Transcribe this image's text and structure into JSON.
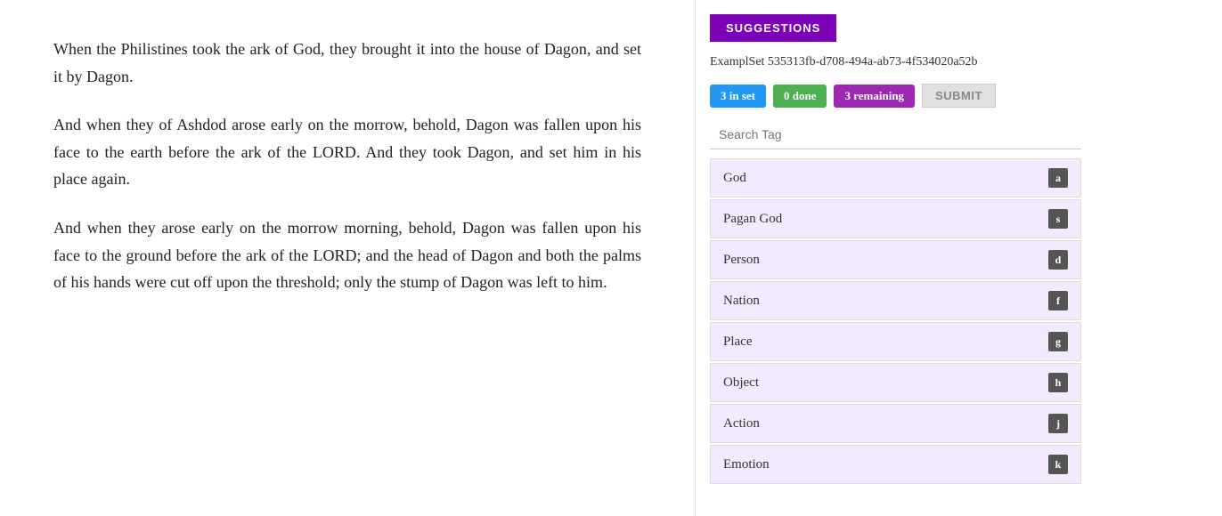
{
  "content": {
    "paragraphs": [
      "When the Philistines took the ark of God, they brought it into the house of Dagon, and set it by Dagon.",
      "And when they of Ashdod arose early on the morrow, behold, Dagon was fallen upon his face to the earth before the ark of the LORD. And they took Dagon, and set him in his place again.",
      "And when they arose early on the morrow morning, behold, Dagon was fallen upon his face to the ground before the ark of the LORD; and the head of Dagon and both the palms of his hands were cut off upon the threshold; only the stump of Dagon was left to him."
    ]
  },
  "sidebar": {
    "suggestions_label": "SUGGESTIONS",
    "example_set_id": "ExamplSet 535313fb-d708-494a-ab73-4f534020a52b",
    "badges": {
      "in_set": "3 in set",
      "done": "0 done",
      "remaining": "3 remaining"
    },
    "submit_label": "SUBMIT",
    "search_placeholder": "Search Tag",
    "tags": [
      {
        "label": "God",
        "key": "a"
      },
      {
        "label": "Pagan God",
        "key": "s"
      },
      {
        "label": "Person",
        "key": "d"
      },
      {
        "label": "Nation",
        "key": "f"
      },
      {
        "label": "Place",
        "key": "g"
      },
      {
        "label": "Object",
        "key": "h"
      },
      {
        "label": "Action",
        "key": "j"
      },
      {
        "label": "Emotion",
        "key": "k"
      }
    ]
  }
}
